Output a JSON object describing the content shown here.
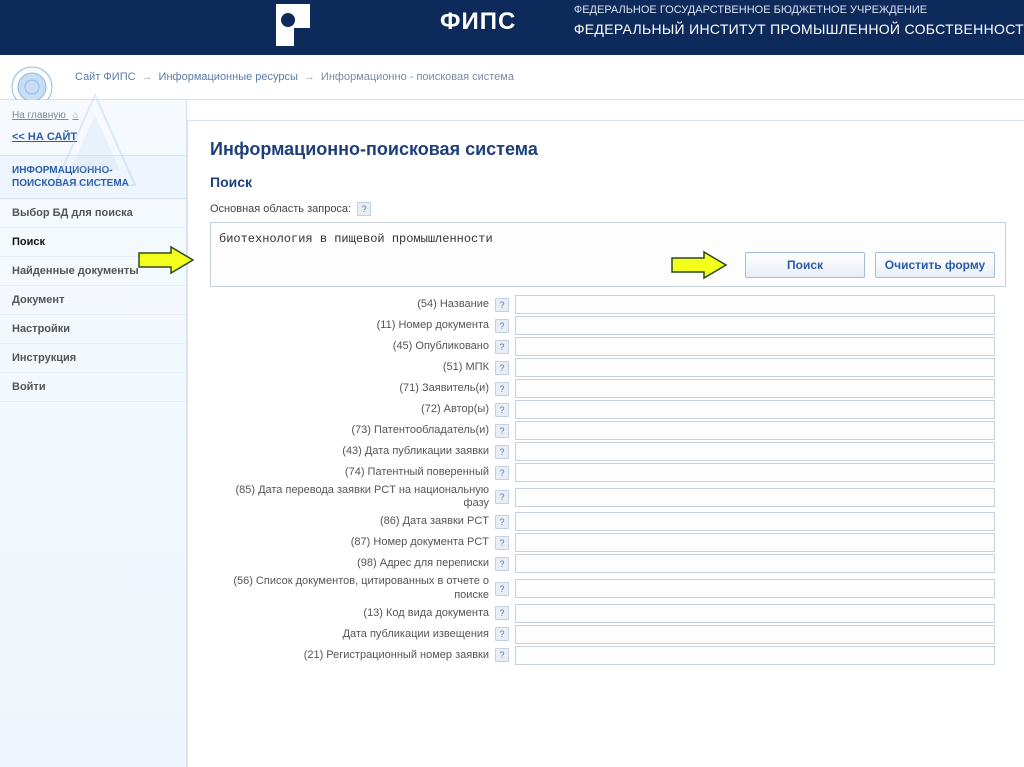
{
  "header": {
    "brand": "ФИПС",
    "subtitle_line1": "ФЕДЕРАЛЬНОЕ ГОСУДАРСТВЕННОЕ БЮДЖЕТНОЕ УЧРЕЖДЕНИЕ",
    "subtitle_line2": "ФЕДЕРАЛЬНЫЙ ИНСТИТУТ ПРОМЫШЛЕННОЙ СОБСТВЕННОСТ"
  },
  "breadcrumb": {
    "items": [
      "Сайт ФИПС",
      "Информационные ресурсы",
      "Информационно - поисковая система"
    ]
  },
  "sidebar": {
    "home_link": "На главную",
    "back_link": "<< НА САЙТ",
    "section_title": "ИНФОРМАЦИОННО-ПОИСКОВАЯ СИСТЕМА",
    "items": [
      "Выбор БД для поиска",
      "Поиск",
      "Найденные документы",
      "Документ",
      "Настройки",
      "Инструкция",
      "Войти"
    ],
    "active_index": 1
  },
  "page": {
    "title": "Информационно-поисковая система",
    "subtitle": "Поиск",
    "main_query_label": "Основная область запроса:",
    "main_query_value": "биотехнология в пищевой промышленности",
    "search_button": "Поиск",
    "clear_button": "Очистить форму",
    "help_glyph": "?"
  },
  "fields": [
    {
      "label": "(54) Название"
    },
    {
      "label": "(11) Номер документа"
    },
    {
      "label": "(45) Опубликовано"
    },
    {
      "label": "(51) МПК"
    },
    {
      "label": "(71) Заявитель(и)"
    },
    {
      "label": "(72) Автор(ы)"
    },
    {
      "label": "(73) Патентообладатель(и)"
    },
    {
      "label": "(43) Дата публикации заявки"
    },
    {
      "label": "(74) Патентный поверенный"
    },
    {
      "label": "(85) Дата перевода заявки PCT на национальную фазу"
    },
    {
      "label": "(86) Дата заявки PCT"
    },
    {
      "label": "(87) Номер документа PCT"
    },
    {
      "label": "(98) Адрес для переписки"
    },
    {
      "label": "(56) Список документов, цитированных в отчете о поиске"
    },
    {
      "label": "(13) Код вида документа"
    },
    {
      "label": "Дата публикации извещения"
    },
    {
      "label": "(21) Регистрационный номер заявки"
    }
  ]
}
